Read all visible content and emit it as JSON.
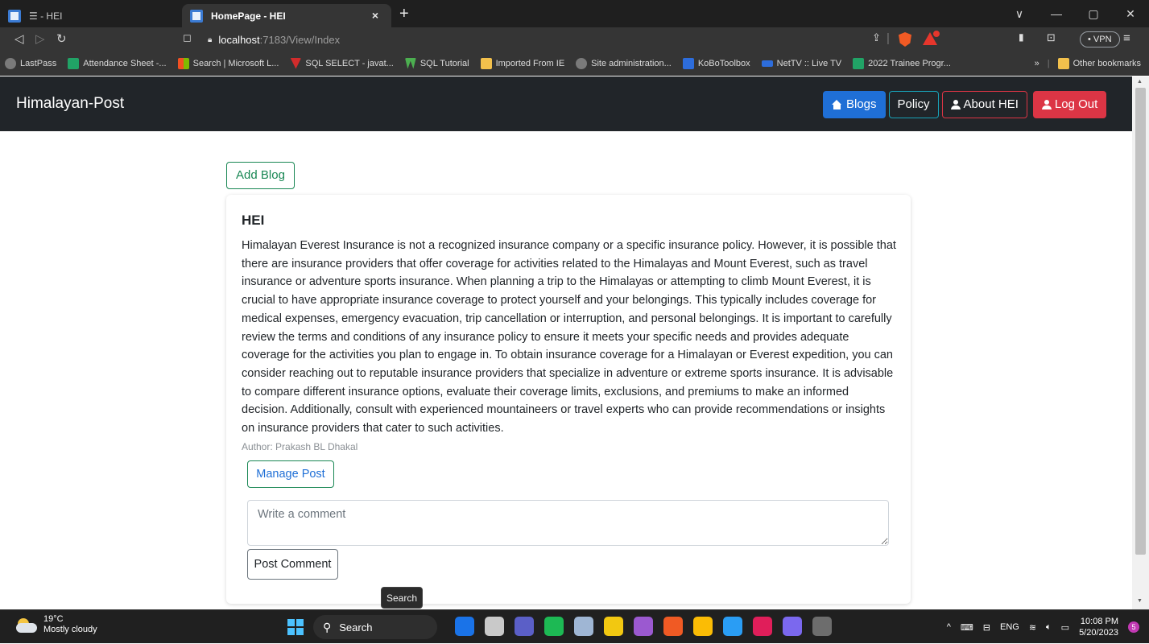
{
  "browser": {
    "tabs": [
      {
        "label": "☰ - HEI",
        "active": false
      },
      {
        "label": "HomePage - HEI",
        "active": true
      }
    ],
    "new_tab": "+",
    "tab_close": "×",
    "window_controls": [
      "∨",
      "—",
      "▢",
      "✕"
    ],
    "url": {
      "host": "localhost",
      "path": ":7183/View/Index"
    },
    "vpn_label": "• VPN",
    "bookmarks": [
      {
        "label": "LastPass",
        "color": "#7a7a7a"
      },
      {
        "label": "Attendance Sheet -...",
        "color": "#21a366"
      },
      {
        "label": "Search | Microsoft L...",
        "color": "#f25022"
      },
      {
        "label": "SQL SELECT - javat...",
        "color": "#d12c2c"
      },
      {
        "label": "SQL Tutorial",
        "color": "#4caf50"
      },
      {
        "label": "Imported From IE",
        "color": "#f2c04c"
      },
      {
        "label": "Site administration...",
        "color": "#7a7a7a"
      },
      {
        "label": "KoBoToolbox",
        "color": "#2d6ddc"
      },
      {
        "label": "NetTV :: Live TV",
        "color": "#2d6ddc"
      },
      {
        "label": "2022 Trainee Progr...",
        "color": "#21a366"
      }
    ],
    "bookmarks_more": "»",
    "other_bookmarks": "Other bookmarks"
  },
  "navbar": {
    "brand": "Himalayan-Post",
    "links": {
      "blogs": "Blogs",
      "policy": "Policy",
      "about": "About HEI",
      "logout": "Log Out"
    },
    "colors": {
      "blogs": "#1f6fd6",
      "policy": "#18a2b8",
      "about": "#dc3545",
      "logout": "#dc3545"
    }
  },
  "page": {
    "add_blog_label": "Add Blog",
    "post": {
      "title": "HEI",
      "body": "Himalayan Everest Insurance is not a recognized insurance company or a specific insurance policy. However, it is possible that there are insurance providers that offer coverage for activities related to the Himalayas and Mount Everest, such as travel insurance or adventure sports insurance. When planning a trip to the Himalayas or attempting to climb Mount Everest, it is crucial to have appropriate insurance coverage to protect yourself and your belongings. This typically includes coverage for medical expenses, emergency evacuation, trip cancellation or interruption, and personal belongings. It is important to carefully review the terms and conditions of any insurance policy to ensure it meets your specific needs and provides adequate coverage for the activities you plan to engage in. To obtain insurance coverage for a Himalayan or Everest expedition, you can consider reaching out to reputable insurance providers that specialize in adventure or extreme sports insurance. It is advisable to compare different insurance options, evaluate their coverage limits, exclusions, and premiums to make an informed decision. Additionally, consult with experienced mountaineers or travel experts who can provide recommendations or insights on insurance providers that cater to such activities.",
      "author": "Author: Prakash BL Dhakal",
      "manage_label": "Manage Post",
      "comment_placeholder": "Write a comment",
      "comment_value": "",
      "post_comment_label": "Post Comment"
    },
    "tooltip": "Search"
  },
  "taskbar": {
    "weather": {
      "temp": "19°C",
      "condition": "Mostly cloudy"
    },
    "search_label": "Search",
    "apps": [
      {
        "name": "app-icon-1",
        "color": "#1a73e8"
      },
      {
        "name": "app-icon-2",
        "color": "#c9c9c9"
      },
      {
        "name": "app-icon-3",
        "color": "#5b5fc7"
      },
      {
        "name": "app-icon-4",
        "color": "#1db954"
      },
      {
        "name": "app-icon-5",
        "color": "#9fb6d4"
      },
      {
        "name": "app-icon-6",
        "color": "#f2c811"
      },
      {
        "name": "app-icon-7",
        "color": "#9b59d0"
      },
      {
        "name": "app-icon-8",
        "color": "#f05a24"
      },
      {
        "name": "app-icon-9",
        "color": "#fbbc05"
      },
      {
        "name": "app-icon-10",
        "color": "#2a9df4"
      },
      {
        "name": "app-icon-11",
        "color": "#e01e5a"
      },
      {
        "name": "app-icon-12",
        "color": "#7b68ee"
      },
      {
        "name": "app-icon-13",
        "color": "#6d6d6d"
      }
    ],
    "language": "ENG",
    "time": "10:08 PM",
    "date": "5/20/2023",
    "notification_count": "5"
  }
}
